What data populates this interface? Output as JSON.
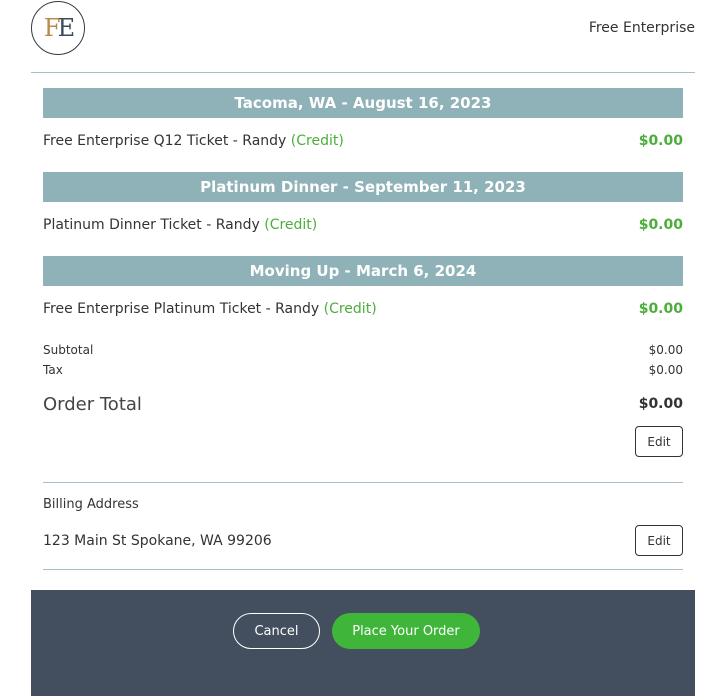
{
  "header": {
    "logo": "FE",
    "logo_letters": [
      "F",
      "E"
    ],
    "brand_name": "Free Enterprise"
  },
  "events": [
    {
      "title": "Tacoma, WA - August 16, 2023",
      "item": "Free Enterprise Q12 Ticket - Randy",
      "note": "(Credit)",
      "price": "$0.00"
    },
    {
      "title": "Platinum Dinner - September 11, 2023",
      "item": "Platinum Dinner Ticket - Randy",
      "note": "(Credit)",
      "price": "$0.00"
    },
    {
      "title": "Moving Up - March 6, 2024",
      "item": "Free Enterprise Platinum Ticket - Randy",
      "note": "(Credit)",
      "price": "$0.00"
    }
  ],
  "summary": {
    "subtotal_label": "Subtotal",
    "subtotal": "$0.00",
    "tax_label": "Tax",
    "tax": "$0.00",
    "total_label": "Order Total",
    "total": "$0.00",
    "edit_label": "Edit"
  },
  "billing": {
    "label": "Billing Address",
    "address": "123 Main St Spokane, WA 99206",
    "edit_label": "Edit"
  },
  "footer": {
    "cancel_label": "Cancel",
    "place_order_label": "Place Your Order"
  },
  "colors": {
    "section_bar": "#8fb2b8",
    "credit_green": "#4cae3a",
    "footer_bg": "#434f5e",
    "primary_button": "#3fb53a"
  }
}
